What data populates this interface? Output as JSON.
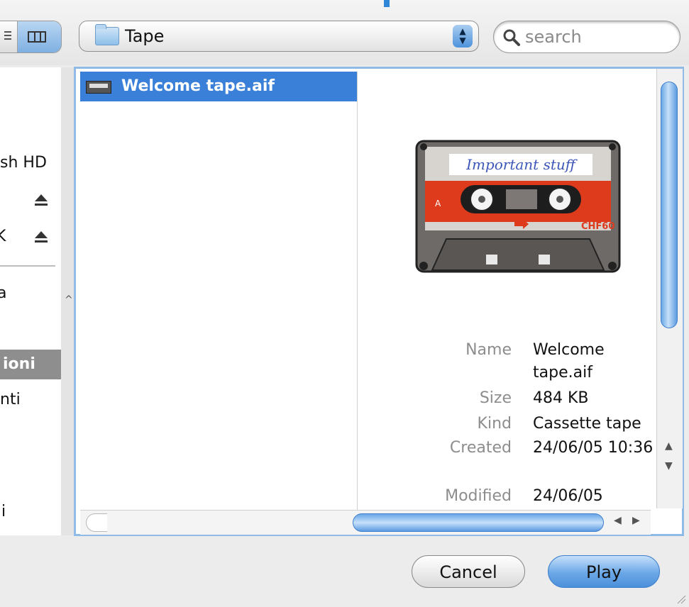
{
  "window": {
    "title_accent_color": "#2f87d8"
  },
  "toolbar": {
    "view_list_icon": "list-view-icon",
    "view_columns_icon": "column-view-icon",
    "path_popup": {
      "label": "Tape",
      "icon": "folder-icon"
    },
    "search": {
      "placeholder": "search",
      "value": ""
    }
  },
  "sidebar": {
    "items": [
      {
        "label": "sh HD"
      },
      {
        "label": "",
        "eject": true
      },
      {
        "label": "K",
        "eject": true
      },
      {
        "label": "a"
      },
      {
        "label": "ioni",
        "selected": true
      },
      {
        "label": "nti"
      },
      {
        "label": "i"
      }
    ]
  },
  "browser": {
    "files": [
      {
        "name": "Welcome tape.aif",
        "icon": "cassette-tape-icon",
        "selected": true
      }
    ],
    "preview": {
      "cassette_label": "Important stuff",
      "cassette_side": "A",
      "cassette_brand": "CHF60",
      "info": [
        {
          "label": "Name",
          "value": "Welcome tape.aif"
        },
        {
          "label": "Size",
          "value": "484 KB"
        },
        {
          "label": "Kind",
          "value": "Cassette tape"
        },
        {
          "label": "Created",
          "value": "24/06/05 10:36"
        },
        {
          "label": "Modified",
          "value": "24/06/05"
        }
      ]
    }
  },
  "buttons": {
    "cancel": "Cancel",
    "play": "Play"
  },
  "colors": {
    "selection": "#3b80d8",
    "focus_ring": "#8fbbe6",
    "sidebar_selected": "#8e8e8e"
  }
}
